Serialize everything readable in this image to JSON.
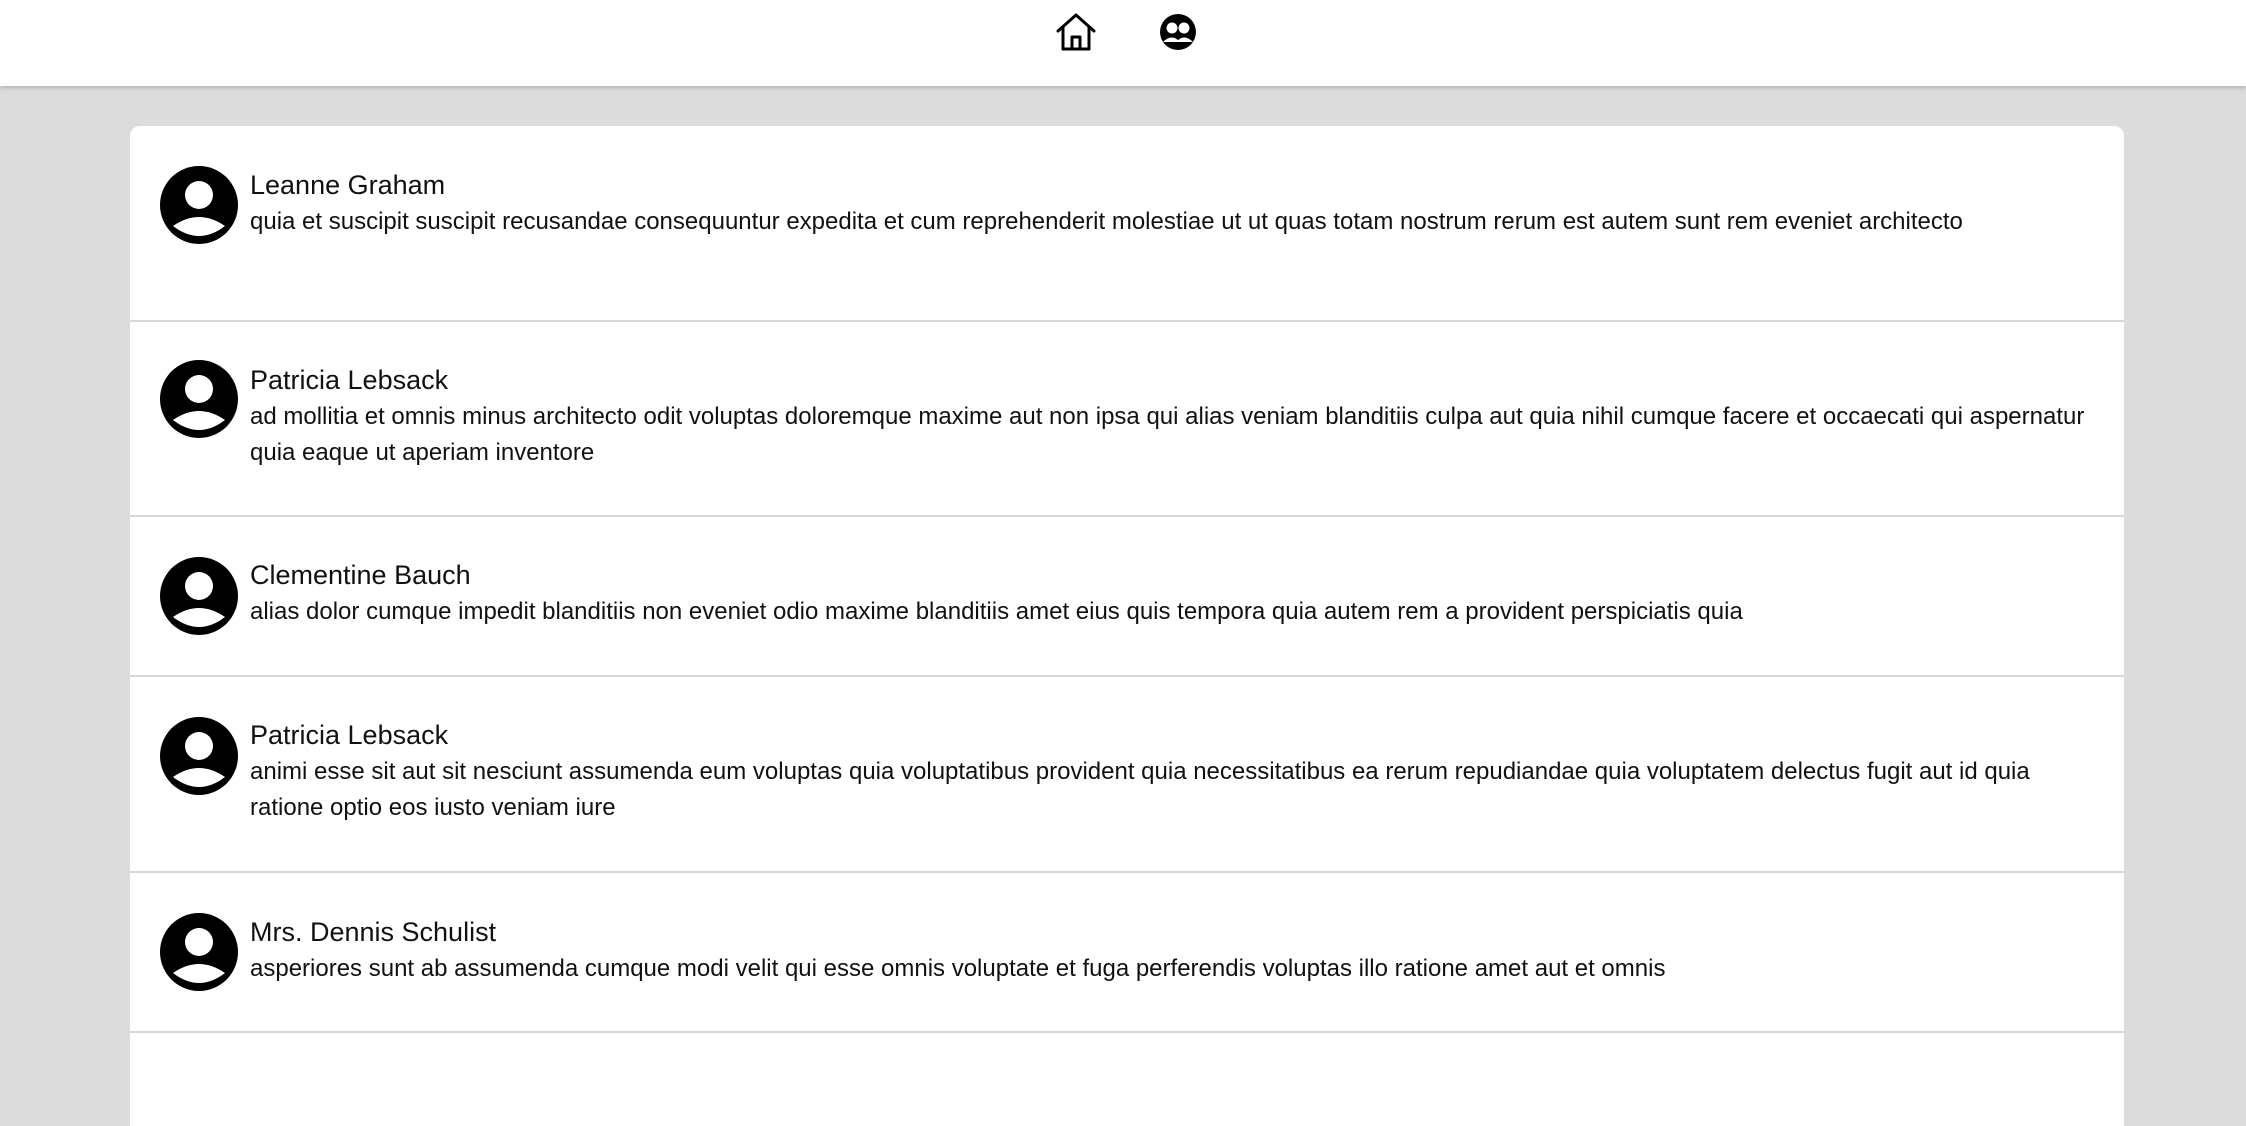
{
  "nav": {
    "items": [
      {
        "name": "home",
        "icon": "home-icon"
      },
      {
        "name": "users",
        "icon": "users-icon"
      }
    ]
  },
  "posts": [
    {
      "author": "Leanne Graham",
      "body": "quia et suscipit suscipit recusandae consequuntur expedita et cum reprehenderit molestiae ut ut quas totam nostrum rerum est autem sunt rem eveniet architecto",
      "avatar_icon": "user-avatar-icon"
    },
    {
      "author": "Patricia Lebsack",
      "body": "ad mollitia et omnis minus architecto odit voluptas doloremque maxime aut non ipsa qui alias veniam blanditiis culpa aut quia nihil cumque facere et occaecati qui aspernatur quia eaque ut aperiam inventore",
      "avatar_icon": "user-avatar-icon"
    },
    {
      "author": "Clementine Bauch",
      "body": "alias dolor cumque impedit blanditiis non eveniet odio maxime blanditiis amet eius quis tempora quia autem rem a provident perspiciatis quia",
      "avatar_icon": "user-avatar-icon"
    },
    {
      "author": "Patricia Lebsack",
      "body": "animi esse sit aut sit nesciunt assumenda eum voluptas quia voluptatibus provident quia necessitatibus ea rerum repudiandae quia voluptatem delectus fugit aut id quia ratione optio eos iusto veniam iure",
      "avatar_icon": "user-avatar-icon"
    },
    {
      "author": "Mrs. Dennis Schulist",
      "body": "asperiores sunt ab assumenda cumque modi velit qui esse omnis voluptate et fuga perferendis voluptas illo ratione amet aut et omnis",
      "avatar_icon": "user-avatar-icon"
    }
  ]
}
